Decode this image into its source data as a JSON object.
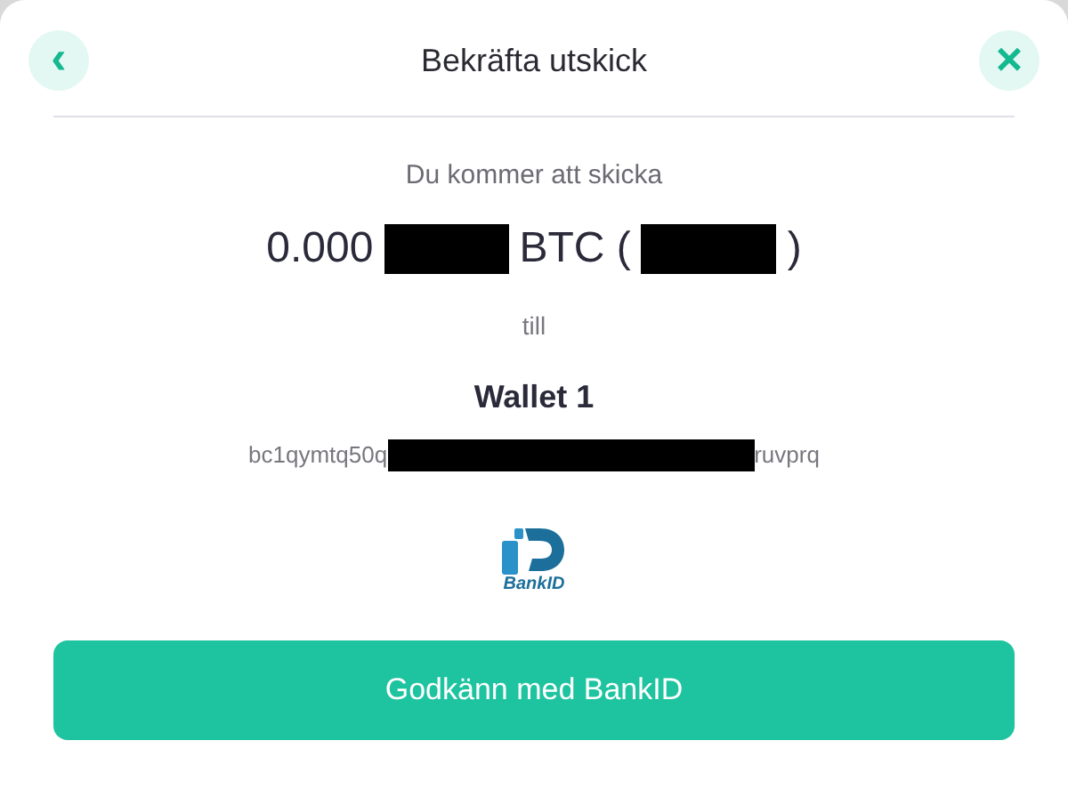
{
  "header": {
    "back_icon": "‹",
    "title": "Bekräfta utskick",
    "close_icon": "×"
  },
  "intro": "Du kommer att skicka",
  "amount": [
    {
      "kind": "text",
      "text": "0.000"
    },
    {
      "kind": "redacted"
    },
    {
      "kind": "text",
      "text": "BTC ("
    },
    {
      "kind": "redacted"
    },
    {
      "kind": "text",
      "text": ")"
    }
  ],
  "connector": "till",
  "wallet_name": "Wallet 1",
  "address": [
    {
      "kind": "text",
      "text": "bc1qymtq50q"
    },
    {
      "kind": "redacted"
    },
    {
      "kind": "text",
      "text": "ruvprq"
    }
  ],
  "logo_text": "BankID",
  "confirm_button": "Godkänn med BankID"
}
